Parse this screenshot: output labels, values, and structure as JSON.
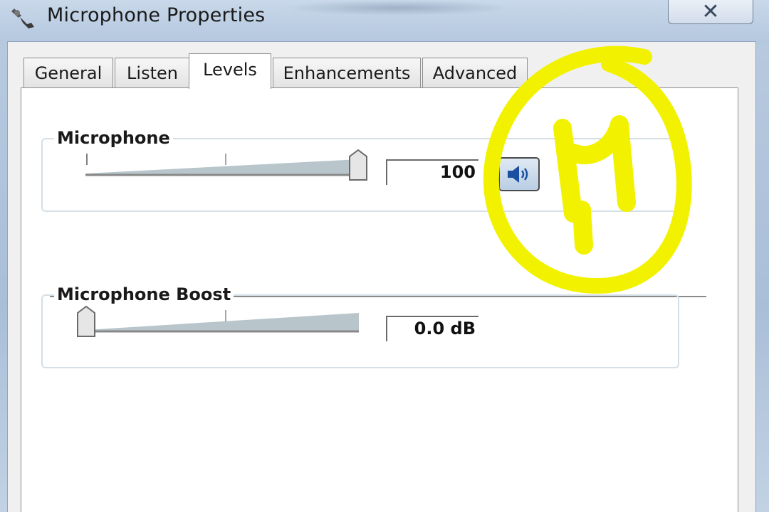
{
  "window": {
    "title": "Microphone Properties",
    "close_glyph": "✕"
  },
  "tabs": [
    {
      "label": "General",
      "active": false
    },
    {
      "label": "Listen",
      "active": false
    },
    {
      "label": "Levels",
      "active": true
    },
    {
      "label": "Enhancements",
      "active": false
    },
    {
      "label": "Advanced",
      "active": false
    }
  ],
  "levels": {
    "microphone": {
      "label": "Microphone",
      "value": "100",
      "level_fraction": 1.0,
      "mute_icon": "speaker-icon"
    },
    "boost": {
      "label": "Microphone Boost",
      "value": "0.0 dB",
      "level_fraction": 0.0
    }
  },
  "annotation": {
    "mark_color": "#f2f200",
    "description_icon": "handwritten-number-annotation"
  }
}
